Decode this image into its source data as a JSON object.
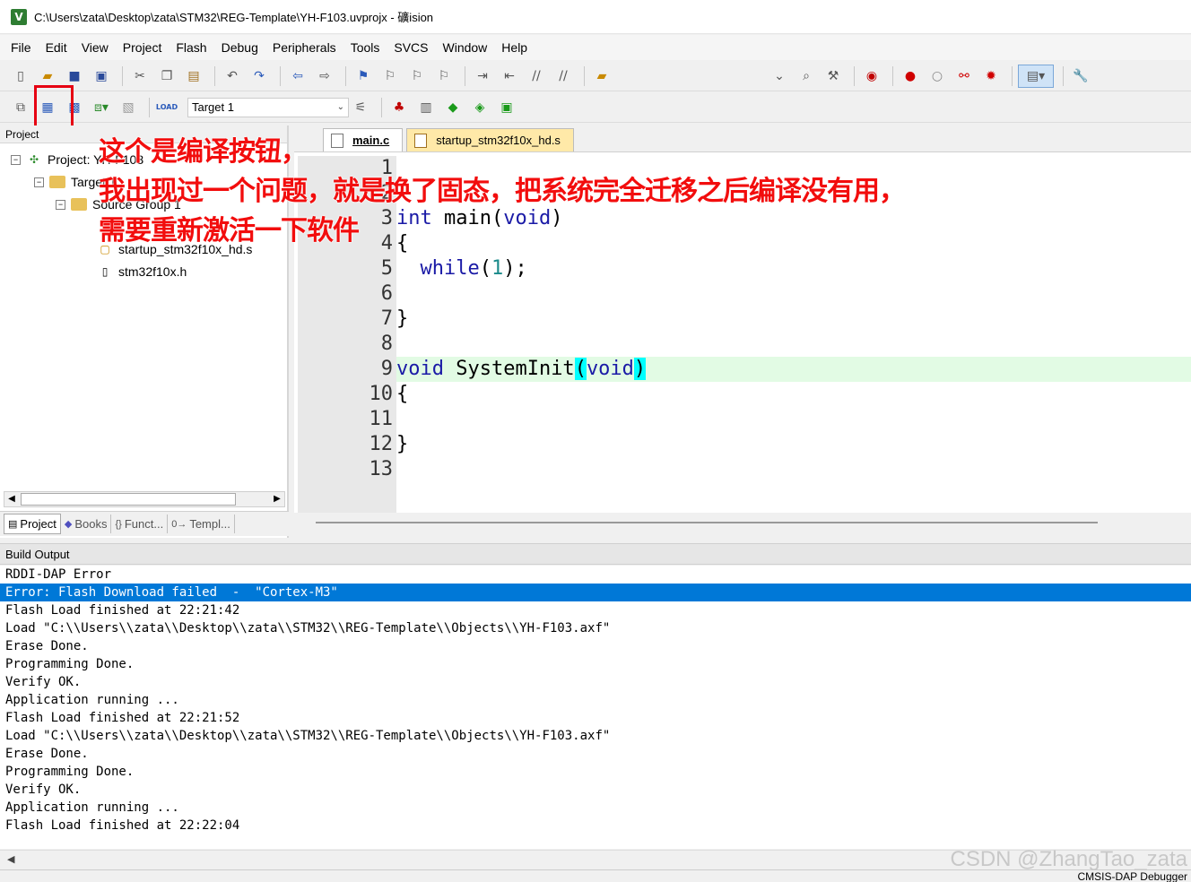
{
  "window": {
    "title": "C:\\Users\\zata\\Desktop\\zata\\STM32\\REG-Template\\YH-F103.uvprojx - 礦ision",
    "app_icon": "keil-icon"
  },
  "menu": [
    "File",
    "Edit",
    "View",
    "Project",
    "Flash",
    "Debug",
    "Peripherals",
    "Tools",
    "SVCS",
    "Window",
    "Help"
  ],
  "toolbar2": {
    "target": "Target 1",
    "load_label": "LOAD"
  },
  "project_panel": {
    "header": "Project",
    "tree": [
      {
        "label": "Project: YH-F103"
      },
      {
        "label": "Target 1"
      },
      {
        "label": "Source Group 1"
      },
      {
        "label": "startup_stm32f10x_hd.s"
      },
      {
        "label": "stm32f10x.h"
      }
    ],
    "tabs": [
      "Project",
      "Books",
      "Funct...",
      "Templ..."
    ]
  },
  "editor": {
    "tabs": [
      "main.c",
      "startup_stm32f10x_hd.s"
    ],
    "lines": [
      {
        "n": "1",
        "code": ""
      },
      {
        "n": "2",
        "code": ""
      },
      {
        "n": "3",
        "code": "int main(void)"
      },
      {
        "n": "4",
        "code": "{"
      },
      {
        "n": "5",
        "code": "    while(1);"
      },
      {
        "n": "6",
        "code": ""
      },
      {
        "n": "7",
        "code": "}"
      },
      {
        "n": "8",
        "code": ""
      },
      {
        "n": "9",
        "code": "void SystemInit(void)"
      },
      {
        "n": "10",
        "code": "{"
      },
      {
        "n": "11",
        "code": ""
      },
      {
        "n": "12",
        "code": "}"
      },
      {
        "n": "13",
        "code": ""
      }
    ]
  },
  "build_output": {
    "header": "Build Output",
    "lines": [
      "RDDI-DAP Error",
      "Error: Flash Download failed  -  \"Cortex-M3\"",
      "Flash Load finished at 22:21:42",
      "Load \"C:\\\\Users\\\\zata\\\\Desktop\\\\zata\\\\STM32\\\\REG-Template\\\\Objects\\\\YH-F103.axf\"",
      "Erase Done.",
      "Programming Done.",
      "Verify OK.",
      "Application running ...",
      "Flash Load finished at 22:21:52",
      "Load \"C:\\\\Users\\\\zata\\\\Desktop\\\\zata\\\\STM32\\\\REG-Template\\\\Objects\\\\YH-F103.axf\"",
      "Erase Done.",
      "Programming Done.",
      "Verify OK.",
      "Application running ...",
      "Flash Load finished at 22:22:04"
    ],
    "selected_index": 1
  },
  "status": {
    "debugger": "CMSIS-DAP Debugger"
  },
  "watermark": "CSDN @ZhangTao_zata",
  "annotation": {
    "line1": "这个是编译按钮，",
    "line2": "我出现过一个问题，就是换了固态，把系统完全迁移之后编译没有用，",
    "line3": "需要重新激活一下软件"
  },
  "colors": {
    "annotation": "#f20d0d",
    "selection": "#0078d7",
    "keyword": "#1a1aa6",
    "highlight_line": "#e2fbe4",
    "paren_match": "#00ffff"
  }
}
